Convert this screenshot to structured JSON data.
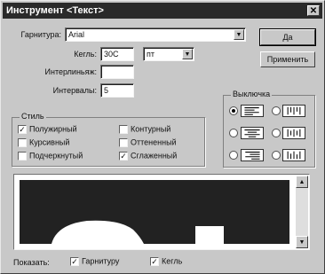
{
  "window": {
    "title": "Инструмент <Текст>",
    "close_glyph": "✕"
  },
  "font": {
    "label": "Гарнитура:",
    "value": "Arial"
  },
  "size": {
    "label": "Кегль:",
    "value": "30C",
    "unit": "пт"
  },
  "leading": {
    "label": "Интерлиньяж:",
    "value": ""
  },
  "spacing": {
    "label": "Интервалы:",
    "value": "5"
  },
  "buttons": {
    "ok": "Да",
    "apply": "Применить"
  },
  "style": {
    "title": "Стиль",
    "options": [
      {
        "label": "Полужирный",
        "checked": true
      },
      {
        "label": "Курсивный",
        "checked": false
      },
      {
        "label": "Подчеркнутый",
        "checked": false
      },
      {
        "label": "Контурный",
        "checked": false
      },
      {
        "label": "Оттененный",
        "checked": false
      },
      {
        "label": "Сглаженный",
        "checked": true
      }
    ]
  },
  "alignment": {
    "title": "Выключка",
    "options": [
      {
        "name": "left",
        "selected": true
      },
      {
        "name": "vertical-left",
        "selected": false
      },
      {
        "name": "center",
        "selected": false
      },
      {
        "name": "vertical-center",
        "selected": false
      },
      {
        "name": "right",
        "selected": false
      },
      {
        "name": "vertical-right",
        "selected": false
      }
    ]
  },
  "footer": {
    "show_label": "Показать:",
    "show_font": {
      "label": "Гарнитуру",
      "checked": true
    },
    "show_size": {
      "label": "Кегль",
      "checked": true
    }
  },
  "icons": {
    "dropdown": "▼",
    "scroll_up": "▲",
    "scroll_down": "▼",
    "check": "✓"
  }
}
